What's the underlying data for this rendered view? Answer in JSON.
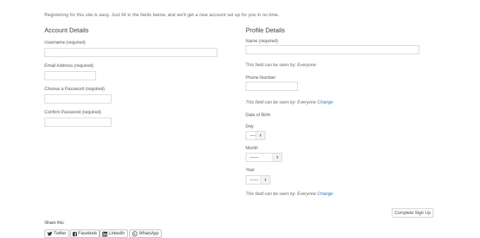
{
  "intro_text": "Registering for this site is easy. Just fill in the fields below, and we'll get a new account set up for you in no time.",
  "account": {
    "title": "Account Details",
    "username_label": "Username (required)",
    "email_label": "Email Address (required)",
    "password_label": "Choose a Password (required)",
    "confirm_label": "Confirm Password (required)"
  },
  "profile": {
    "title": "Profile Details",
    "name_label": "Name (required)",
    "name_visibility": "This field can be seen by: Everyone",
    "phone_label": "Phone Number",
    "phone_visibility": "This field can be seen by: Everyone",
    "phone_change": "Change",
    "dob_label": "Date of Birth",
    "day_label": "Day",
    "day_value": "—-",
    "month_label": "Month",
    "month_value": "——",
    "year_label": "Year",
    "year_value": "——",
    "dob_visibility": "This field can be seen by: Everyone",
    "dob_change": "Change"
  },
  "submit_label": "Complete Sign Up",
  "share": {
    "label": "Share this:",
    "buttons": {
      "twitter": "Twitter",
      "facebook": "Facebook",
      "linkedin": "LinkedIn",
      "whatsapp": "WhatsApp"
    }
  }
}
